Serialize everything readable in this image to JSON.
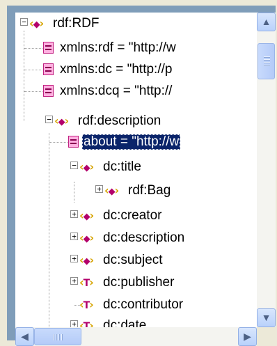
{
  "tree": {
    "nodes": [
      {
        "kind": "element",
        "label": "rdf:RDF",
        "expander": "−"
      },
      {
        "kind": "attribute",
        "label": "xmlns:rdf = \"http://w"
      },
      {
        "kind": "attribute",
        "label": "xmlns:dc = \"http://p"
      },
      {
        "kind": "attribute",
        "label": "xmlns:dcq = \"http://"
      },
      {
        "kind": "element",
        "label": "rdf:description",
        "expander": "−"
      },
      {
        "kind": "attribute",
        "label": "about = \"http://w",
        "selected": true
      },
      {
        "kind": "element",
        "label": "dc:title",
        "expander": "−"
      },
      {
        "kind": "element",
        "label": "rdf:Bag",
        "expander": "+"
      },
      {
        "kind": "element",
        "label": "dc:creator",
        "expander": "+"
      },
      {
        "kind": "element",
        "label": "dc:description",
        "expander": "+"
      },
      {
        "kind": "element",
        "label": "dc:subject",
        "expander": "+"
      },
      {
        "kind": "text-element",
        "label": "dc:publisher",
        "expander": "+"
      },
      {
        "kind": "text-element",
        "label": "dc:contributor"
      },
      {
        "kind": "text-element",
        "label": "dc:date",
        "expander": "+"
      }
    ],
    "icons": {
      "element": "element-node-icon",
      "attribute": "attribute-node-icon",
      "text-element": "text-element-node-icon"
    }
  },
  "scrollbars": {
    "up": "▲",
    "down": "▼",
    "left": "◀",
    "right": "▶"
  },
  "colors": {
    "selection": "#0a246a",
    "scrollbar": "#c1d3fb"
  }
}
